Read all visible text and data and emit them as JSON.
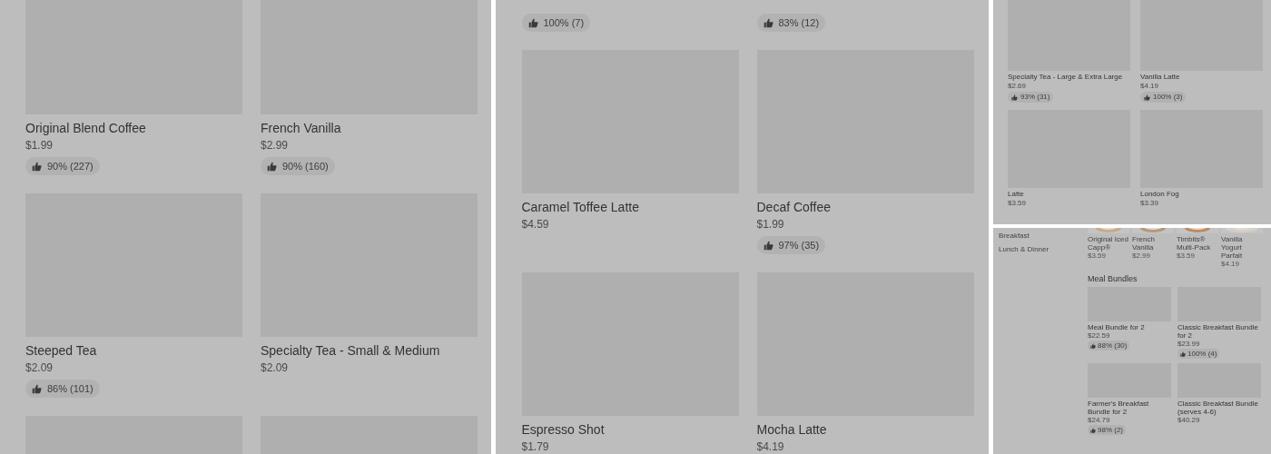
{
  "panels": [
    {
      "kind": "large",
      "items": [
        {
          "kind": "card",
          "name": "Original Blend Coffee",
          "price": "$1.99",
          "rating": "90% (227)"
        },
        {
          "kind": "card",
          "name": "French Vanilla",
          "price": "$2.99",
          "rating": "90% (160)"
        },
        {
          "kind": "card",
          "name": "Steeped Tea",
          "price": "$2.09",
          "rating": "86% (101)"
        },
        {
          "kind": "card",
          "name": "Specialty Tea - Small & Medium",
          "price": "$2.09"
        },
        {
          "kind": "placeholder"
        },
        {
          "kind": "placeholder"
        }
      ]
    },
    {
      "kind": "large",
      "items": [
        {
          "kind": "rating_only",
          "rating": "100% (7)"
        },
        {
          "kind": "rating_only",
          "rating": "83% (12)"
        },
        {
          "kind": "card",
          "name": "Caramel Toffee Latte",
          "price": "$4.59"
        },
        {
          "kind": "card",
          "name": "Decaf Coffee",
          "price": "$1.99",
          "rating": "97% (35)"
        },
        {
          "kind": "card",
          "name": "Espresso Shot",
          "price": "$1.79"
        },
        {
          "kind": "card",
          "name": "Mocha Latte",
          "price": "$4.19"
        }
      ]
    },
    {
      "kind": "small",
      "items": [
        {
          "kind": "card",
          "name": "Specialty Tea - Large & Extra Large",
          "price": "$2.69",
          "rating": "93% (31)"
        },
        {
          "kind": "card",
          "name": "Vanilla Latte",
          "price": "$4.19",
          "rating": "100% (3)"
        },
        {
          "kind": "card",
          "name": "Latte",
          "price": "$3.59"
        },
        {
          "kind": "card",
          "name": "London Fog",
          "price": "$3.39"
        }
      ]
    }
  ],
  "store": {
    "sidebar": [
      "Breakfast",
      "Lunch & Dinner"
    ],
    "strip": [
      {
        "name": "Original Iced Capp®",
        "price": "$3.59"
      },
      {
        "name": "French Vanilla",
        "price": "$2.99"
      },
      {
        "name": "Timbits® Multi-Pack",
        "price": "$3.59"
      },
      {
        "name": "Vanilla Yogurt Parfait",
        "price": "$4.19"
      }
    ],
    "section": {
      "title": "Meal Bundles",
      "items": [
        {
          "name": "Meal Bundle for 2",
          "price": "$22.59",
          "rating": "88% (30)"
        },
        {
          "name": "Classic Breakfast Bundle for 2",
          "price": "$23.99",
          "rating": "100% (4)"
        },
        {
          "name": "Farmer's Breakfast Bundle for 2",
          "price": "$24.79",
          "rating": "98% (2)"
        },
        {
          "name": "Classic Breakfast Bundle (serves 4-6)",
          "price": "$40.29"
        }
      ]
    }
  }
}
